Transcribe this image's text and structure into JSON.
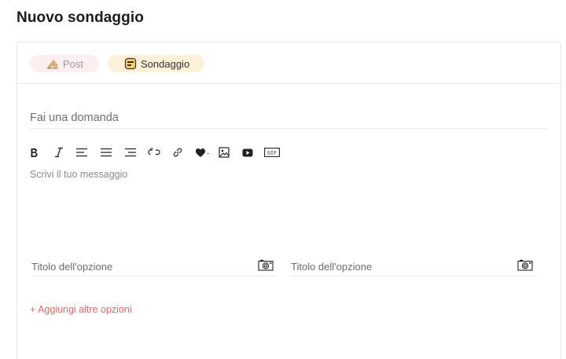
{
  "page": {
    "title": "Nuovo sondaggio"
  },
  "tabs": [
    {
      "label": "Post",
      "icon": "pencil-hand-icon",
      "active": false
    },
    {
      "label": "Sondaggio",
      "icon": "poll-icon",
      "active": true
    }
  ],
  "question": {
    "placeholder": "Fai una domanda",
    "value": ""
  },
  "toolbar": {
    "tools": [
      "bold",
      "italic",
      "align-left",
      "align-center",
      "align-right",
      "unlink",
      "link",
      "heart-emoji",
      "image",
      "video",
      "gif"
    ],
    "gif_label": "GIF"
  },
  "message": {
    "placeholder": "Scrivi il tuo messaggio",
    "value": ""
  },
  "options": [
    {
      "placeholder": "Titolo dell'opzione",
      "value": ""
    },
    {
      "placeholder": "Titolo dell'opzione",
      "value": ""
    }
  ],
  "add_options_label": "+ Aggiungi altre opzioni",
  "colors": {
    "accent": "#e56767",
    "post_pill": "#fdeff0",
    "poll_pill": "#fdf0d8"
  }
}
